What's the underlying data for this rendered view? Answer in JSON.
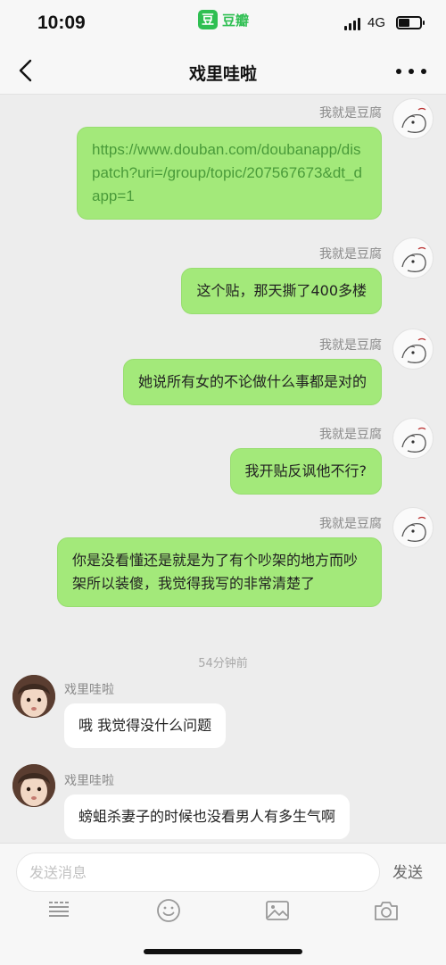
{
  "status_bar": {
    "time": "10:09",
    "app_logo_char": "豆",
    "app_name": "豆瓣",
    "network": "4G"
  },
  "nav": {
    "title": "戏里哇啦"
  },
  "messages": [
    {
      "sender": "我就是豆腐",
      "text": "https://www.douban.com/doubanapp/dispatch?uri=/group/topic/207567673&dt_dapp=1"
    },
    {
      "sender": "我就是豆腐",
      "text": "这个贴，那天撕了400多楼"
    },
    {
      "sender": "我就是豆腐",
      "text": "她说所有女的不论做什么事都是对的"
    },
    {
      "sender": "我就是豆腐",
      "text": "我开贴反讽他不行?"
    },
    {
      "sender": "我就是豆腐",
      "text": "你是没看懂还是就是为了有个吵架的地方而吵架所以装傻，我觉得我写的非常清楚了"
    },
    {
      "sender": "戏里哇啦",
      "text": "哦 我觉得没什么问题"
    },
    {
      "sender": "戏里哇啦",
      "text": "螃蛆杀妻子的时候也没看男人有多生气啊"
    }
  ],
  "timestamp": "54分钟前",
  "input": {
    "placeholder": "发送消息",
    "send_label": "发送"
  },
  "colors": {
    "outgoing_bubble": "#a3e97a",
    "link_text": "#4a9b3a",
    "brand": "#2fbf52"
  }
}
